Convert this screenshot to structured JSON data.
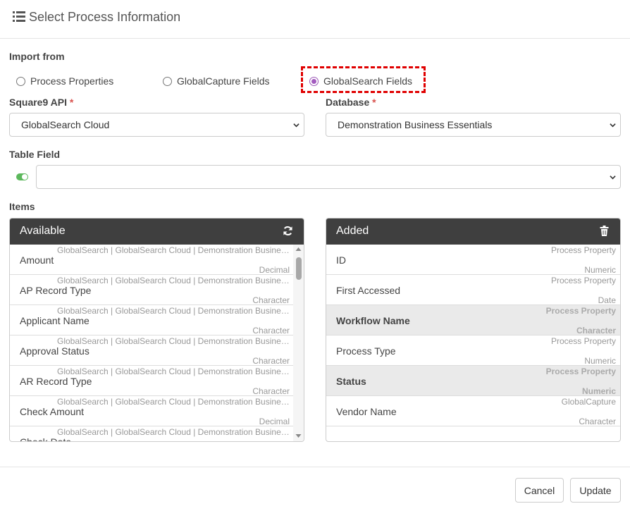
{
  "header": {
    "title": "Select Process Information",
    "icon": "list-icon"
  },
  "import_from": {
    "label": "Import from",
    "options": [
      {
        "label": "Process Properties",
        "checked": false
      },
      {
        "label": "GlobalCapture Fields",
        "checked": false
      },
      {
        "label": "GlobalSearch Fields",
        "checked": true
      }
    ]
  },
  "api": {
    "label": "Square9 API",
    "required": "*",
    "value": "GlobalSearch Cloud"
  },
  "database": {
    "label": "Database",
    "required": "*",
    "value": "Demonstration Business Essentials"
  },
  "table_field": {
    "label": "Table Field",
    "value": ""
  },
  "items_label": "Items",
  "available": {
    "title": "Available",
    "items": [
      {
        "source": "GlobalSearch | GlobalSearch Cloud | Demonstration Business Essentials",
        "name": "Amount",
        "type": "Decimal"
      },
      {
        "source": "GlobalSearch | GlobalSearch Cloud | Demonstration Business Essentials",
        "name": "AP Record Type",
        "type": "Character"
      },
      {
        "source": "GlobalSearch | GlobalSearch Cloud | Demonstration Business Essentials",
        "name": "Applicant Name",
        "type": "Character"
      },
      {
        "source": "GlobalSearch | GlobalSearch Cloud | Demonstration Business Essentials",
        "name": "Approval Status",
        "type": "Character"
      },
      {
        "source": "GlobalSearch | GlobalSearch Cloud | Demonstration Business Essentials",
        "name": "AR Record Type",
        "type": "Character"
      },
      {
        "source": "GlobalSearch | GlobalSearch Cloud | Demonstration Business Essentials",
        "name": "Check Amount",
        "type": "Decimal"
      },
      {
        "source": "GlobalSearch | GlobalSearch Cloud | Demonstration Business Essentials",
        "name": "Check Date",
        "type": ""
      }
    ]
  },
  "added": {
    "title": "Added",
    "items": [
      {
        "source": "Process Property",
        "name": "ID",
        "type": "Numeric",
        "selected": false
      },
      {
        "source": "Process Property",
        "name": "First Accessed",
        "type": "Date",
        "selected": false
      },
      {
        "source": "Process Property",
        "name": "Workflow Name",
        "type": "Character",
        "selected": true
      },
      {
        "source": "Process Property",
        "name": "Process Type",
        "type": "Numeric",
        "selected": false
      },
      {
        "source": "Process Property",
        "name": "Status",
        "type": "Numeric",
        "selected": true
      },
      {
        "source": "GlobalCapture",
        "name": "Vendor Name",
        "type": "Character",
        "selected": false
      }
    ]
  },
  "buttons": {
    "cancel": "Cancel",
    "update": "Update"
  },
  "colors": {
    "accent": "#a35bbf",
    "highlight": "#e00000",
    "panel_header": "#3f3f3f",
    "toggle": "#5cb85c"
  }
}
